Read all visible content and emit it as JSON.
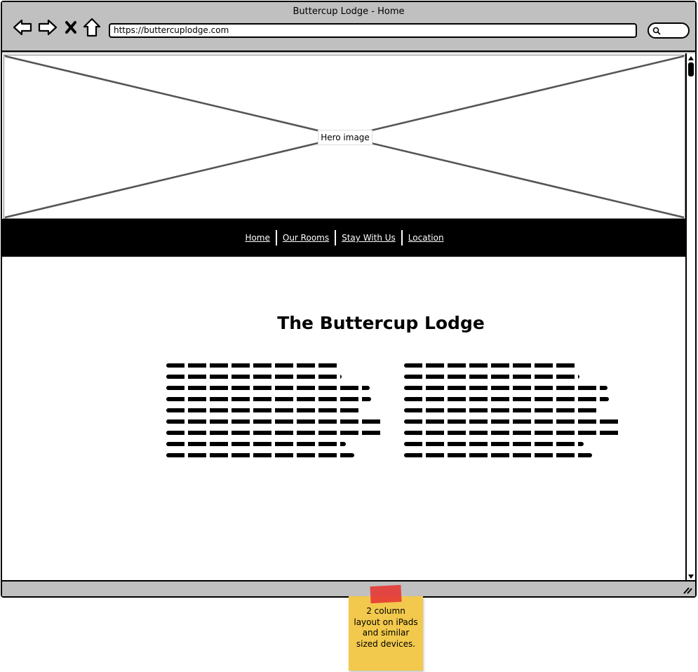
{
  "window": {
    "title": "Buttercup Lodge - Home",
    "url": "https://buttercuplodge.com"
  },
  "toolbar": {
    "icons": [
      "back-icon",
      "forward-icon",
      "stop-icon",
      "home-icon",
      "search-icon"
    ]
  },
  "hero": {
    "label": "Hero image"
  },
  "nav": {
    "items": [
      {
        "label": "Home"
      },
      {
        "label": "Our Rooms"
      },
      {
        "label": "Stay With Us"
      },
      {
        "label": "Location"
      }
    ]
  },
  "main": {
    "title": "The Buttercup Lodge",
    "columns": [
      {
        "lines": 9
      },
      {
        "lines": 9
      }
    ]
  },
  "sticky_note": {
    "text": "2 column layout on iPads and similar sized devices."
  },
  "colors": {
    "chrome": "#c0c0c0",
    "navbar": "#000000",
    "sticky": "#f2c94c",
    "tape": "#e53935"
  }
}
